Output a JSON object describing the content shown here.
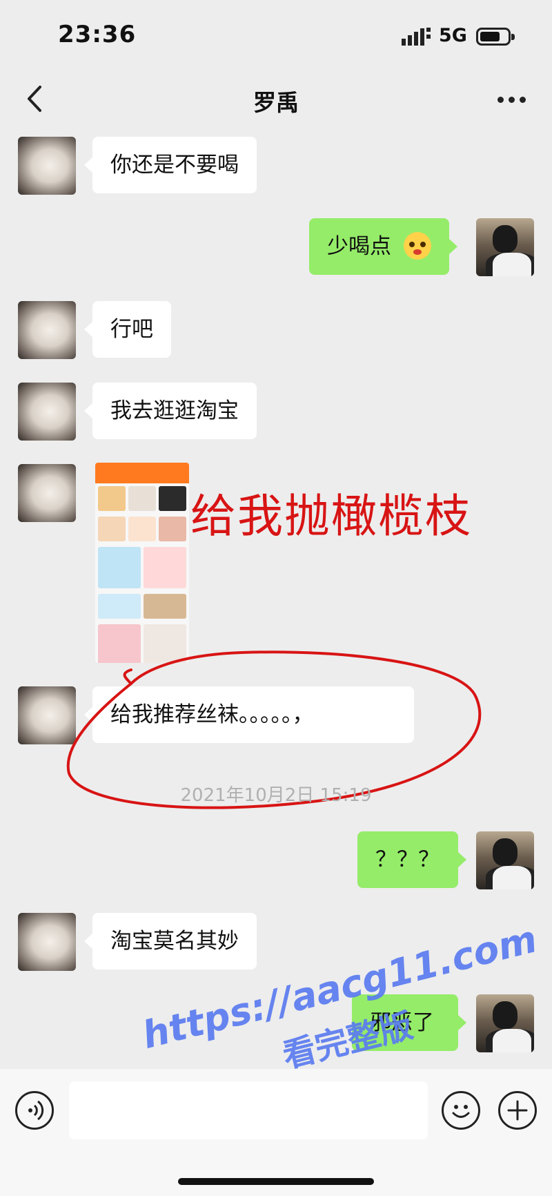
{
  "status": {
    "time": "23:36",
    "network": "5G"
  },
  "nav": {
    "title": "罗禹"
  },
  "messages": [
    {
      "from": "other",
      "text": "你还是不要喝"
    },
    {
      "from": "me",
      "text": "少喝点",
      "emoji": "pleading-face-emoji"
    },
    {
      "from": "other",
      "text": "行吧"
    },
    {
      "from": "other",
      "text": "我去逛逛淘宝"
    },
    {
      "from": "other",
      "type": "image",
      "description": "taobao-screenshot"
    },
    {
      "from": "other",
      "text": "给我推荐丝袜。。。。。，"
    },
    {
      "from": "me",
      "text": "？？？"
    },
    {
      "from": "other",
      "text": "淘宝莫名其妙"
    },
    {
      "from": "me",
      "text": "邪恶了"
    }
  ],
  "timestamp": "2021年10月2日 15:19",
  "annotation": {
    "text": "给我抛橄榄枝",
    "color": "#d81414"
  },
  "watermark": {
    "line1": "https://aacg11.com",
    "line2": "看完整版",
    "color": "#5b7cf0"
  },
  "colors": {
    "bubble_out": "#95ec69",
    "bubble_in": "#ffffff",
    "background": "#ededed"
  }
}
